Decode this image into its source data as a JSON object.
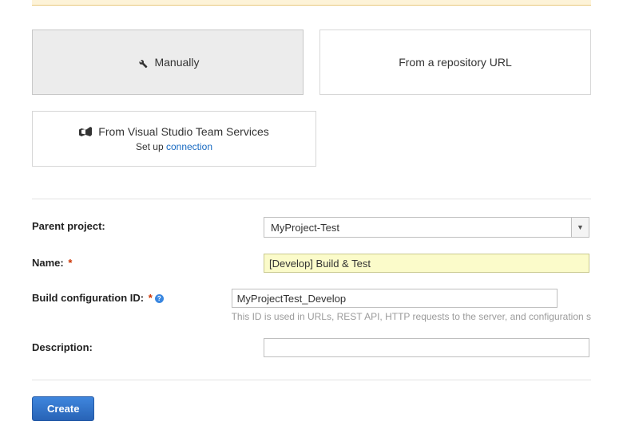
{
  "source_cards": {
    "manual": {
      "label": "Manually"
    },
    "repo_url": {
      "label": "From a repository URL"
    },
    "vsts": {
      "label": "From Visual Studio Team Services",
      "subtext_prefix": "Set up ",
      "connection_link": "connection"
    }
  },
  "form": {
    "parent_project": {
      "label": "Parent project:",
      "value": "MyProject-Test"
    },
    "name": {
      "label": "Name:",
      "value": "[Develop] Build & Test"
    },
    "build_config_id": {
      "label": "Build configuration ID:",
      "value": "MyProjectTest_Develop",
      "hint": "This ID is used in URLs, REST API, HTTP requests to the server, and configuration s"
    },
    "description": {
      "label": "Description:",
      "value": ""
    }
  },
  "actions": {
    "create": "Create"
  }
}
